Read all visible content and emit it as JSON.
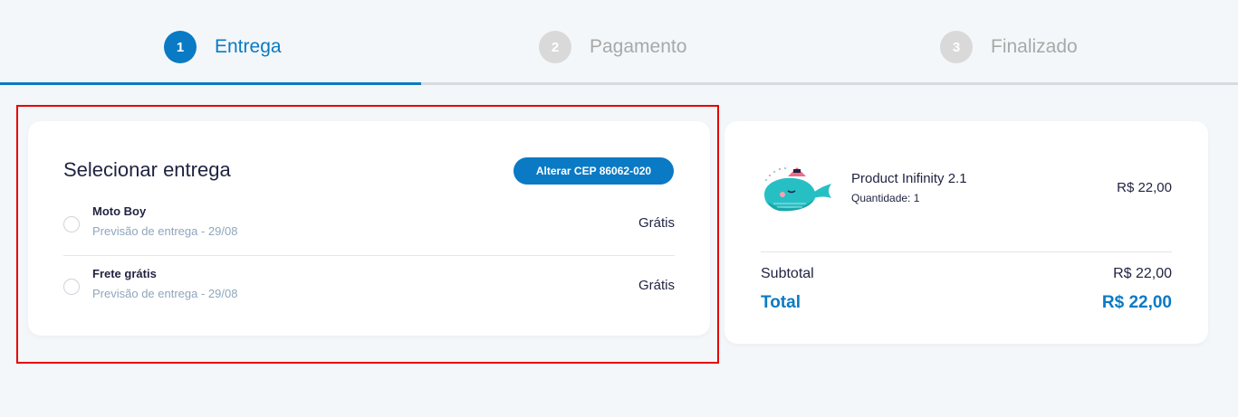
{
  "stepper": {
    "steps": [
      {
        "number": "1",
        "label": "Entrega",
        "state": "active"
      },
      {
        "number": "2",
        "label": "Pagamento",
        "state": "inactive"
      },
      {
        "number": "3",
        "label": "Finalizado",
        "state": "inactive"
      }
    ],
    "progress": 0.34
  },
  "delivery": {
    "title": "Selecionar entrega",
    "cep_button": "Alterar CEP 86062-020",
    "options": [
      {
        "name": "Moto Boy",
        "estimate": "Previsão de entrega - 29/08",
        "price": "Grátis"
      },
      {
        "name": "Frete grátis",
        "estimate": "Previsão de entrega - 29/08",
        "price": "Grátis"
      }
    ]
  },
  "summary": {
    "product": {
      "name": "Product Inifinity 2.1",
      "quantity": "Quantidade: 1",
      "price": "R$ 22,00",
      "image_icon": "whale-illustration"
    },
    "subtotal_label": "Subtotal",
    "subtotal_value": "R$ 22,00",
    "total_label": "Total",
    "total_value": "R$ 22,00"
  },
  "colors": {
    "accent": "#0a7ac4",
    "highlight_border": "#e60000",
    "background": "#f4f7fa",
    "inactive": "#d9d9d9"
  }
}
